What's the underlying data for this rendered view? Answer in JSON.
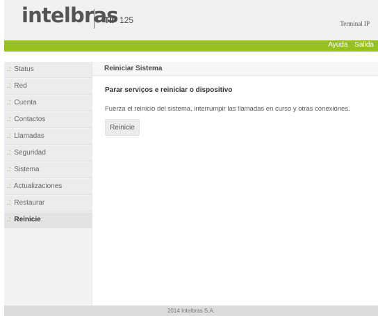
{
  "header": {
    "logo": "intelbras",
    "model_prefix": "TIP",
    "model_number": "125",
    "device_type": "Terminal IP"
  },
  "top_links": {
    "help": "Ayuda",
    "logout": "Salida"
  },
  "sidebar": {
    "prefix": ".:",
    "items": [
      {
        "label": "Status"
      },
      {
        "label": "Red"
      },
      {
        "label": "Cuenta"
      },
      {
        "label": "Contactos"
      },
      {
        "label": "Llamadas"
      },
      {
        "label": "Seguridad"
      },
      {
        "label": "Sistema"
      },
      {
        "label": "Actualizaciones"
      },
      {
        "label": "Restaurar"
      },
      {
        "label": "Reinicie"
      }
    ],
    "active_index": 9
  },
  "content": {
    "title": "Reiniciar Sistema",
    "heading": "Parar serviços e reiniciar o dispositivo",
    "description": "Fuerza el reinicio del sistema, interrumpir las llamadas en curso y otras conexiones.",
    "button_label": "Reinicie"
  },
  "footer": {
    "text": "2014 Intelbras S.A."
  },
  "colors": {
    "accent_green": "#97c11f",
    "header_bg": "#f1f1f1",
    "footer_bg": "#dcdcdc"
  }
}
